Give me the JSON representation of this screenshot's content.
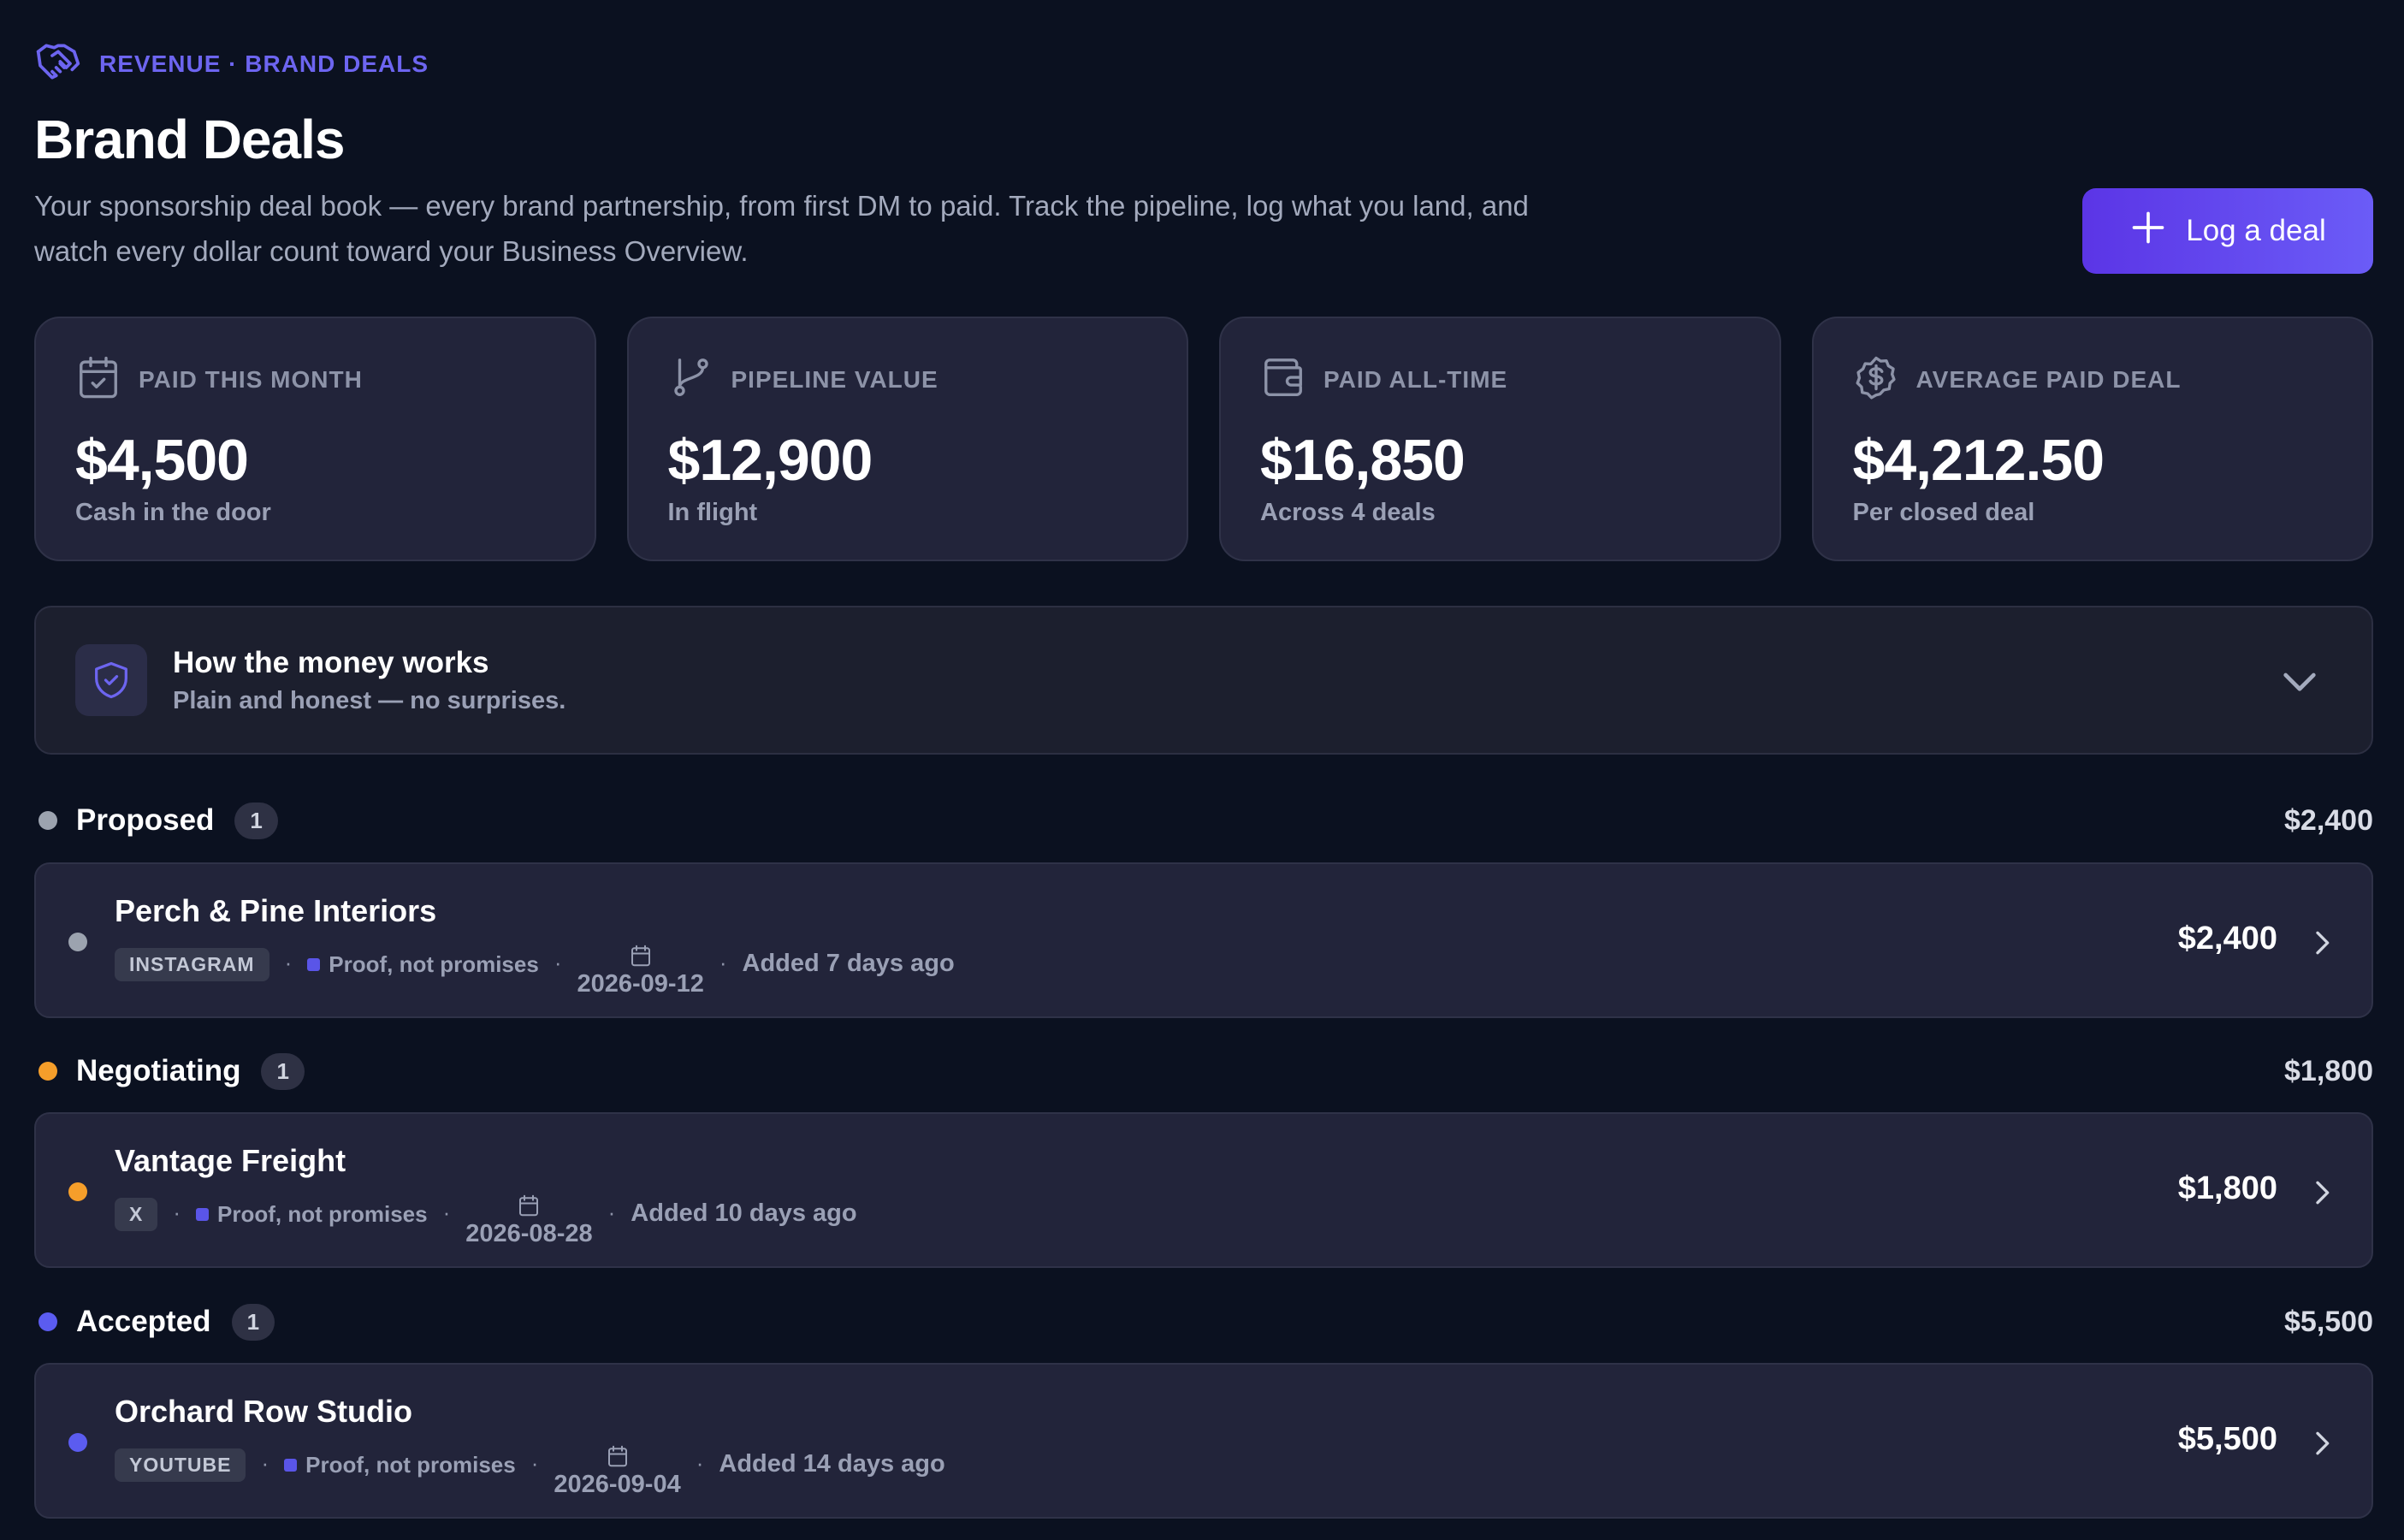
{
  "header": {
    "breadcrumb": "REVENUE · BRAND DEALS",
    "title": "Brand Deals",
    "subtitle": "Your sponsorship deal book — every brand partnership, from first DM to paid. Track the pipeline, log what you land, and watch every dollar count toward your Business Overview.",
    "log_button": "Log a deal",
    "accent": "#6d65f0"
  },
  "stats": [
    {
      "label": "PAID THIS MONTH",
      "value": "$4,500",
      "sub": "Cash in the door",
      "icon": "calendar-check-icon"
    },
    {
      "label": "PIPELINE VALUE",
      "value": "$12,900",
      "sub": "In flight",
      "icon": "git-branch-icon"
    },
    {
      "label": "PAID ALL-TIME",
      "value": "$16,850",
      "sub": "Across 4 deals",
      "icon": "wallet-icon"
    },
    {
      "label": "AVERAGE PAID DEAL",
      "value": "$4,212.50",
      "sub": "Per closed deal",
      "icon": "dollar-badge-icon"
    }
  ],
  "info": {
    "title": "How the money works",
    "subtitle": "Plain and honest — no surprises.",
    "icon": "shield-check-icon"
  },
  "groups": [
    {
      "name": "Proposed",
      "count": "1",
      "total": "$2,400",
      "color": "#9ca3af",
      "deal": {
        "name": "Perch & Pine Interiors",
        "platform": "INSTAGRAM",
        "proof": "Proof, not promises",
        "date": "2026-09-12",
        "added": "Added 7 days ago",
        "amount": "$2,400"
      }
    },
    {
      "name": "Negotiating",
      "count": "1",
      "total": "$1,800",
      "color": "#f59e2a",
      "deal": {
        "name": "Vantage Freight",
        "platform": "X",
        "proof": "Proof, not promises",
        "date": "2026-08-28",
        "added": "Added 10 days ago",
        "amount": "$1,800"
      }
    },
    {
      "name": "Accepted",
      "count": "1",
      "total": "$5,500",
      "color": "#5b5cf0",
      "deal": {
        "name": "Orchard Row Studio",
        "platform": "YOUTUBE",
        "proof": "Proof, not promises",
        "date": "2026-09-04",
        "added": "Added 14 days ago",
        "amount": "$5,500"
      }
    }
  ]
}
